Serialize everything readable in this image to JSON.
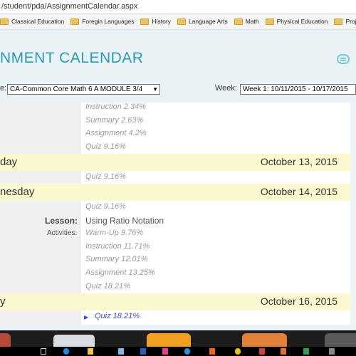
{
  "browser": {
    "url": "/student/pda/AssignmentCalendar.aspx",
    "bookmarks": [
      "Classical Education",
      "Foregin Languages",
      "History",
      "Language Arts",
      "Math",
      "Physical Education",
      "Project Based L"
    ]
  },
  "header": {
    "title": "NMENT CALENDAR",
    "course_label": "e:",
    "course_value": "CA-Common Core Math 6 A MODULE 3/4",
    "week_label": "Week:",
    "week_value": "Week 1: 10/11/2015 - 10/17/2015"
  },
  "calendar": {
    "top_items": [
      "Instruction 2.34%",
      "Summary 2.63%",
      "Assignment 4.2%",
      "Quiz 9.16%"
    ],
    "day1": {
      "name": "day",
      "date": "October 13, 2015",
      "items": [
        "Quiz 9.16%"
      ]
    },
    "day2": {
      "name": "nesday",
      "date": "October 14, 2015",
      "items": [
        "Quiz 9.16%"
      ],
      "lesson_label": "Lesson:",
      "lesson_value": "Using Ratio Notation",
      "activities_label": "Activities:",
      "activities": [
        "Warm-Up 9.76%",
        "Instruction 11.71%",
        "Summary 12.01%",
        "Assignment 13.25%",
        "Quiz 18.21%"
      ]
    },
    "day3": {
      "name": "y",
      "date": "October 16, 2015",
      "items": [
        "Quiz 18.21%"
      ]
    }
  },
  "colors": {
    "accent": "#2d9bb1",
    "day_band": "#fbf7cf",
    "link": "#3b4fb8"
  }
}
